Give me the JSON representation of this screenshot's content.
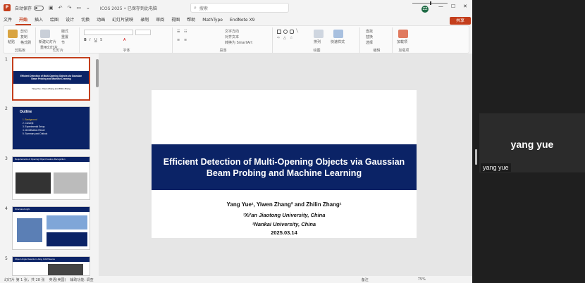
{
  "titlebar": {
    "logo": "P",
    "autosave_label": "自动保存",
    "doc_title": "ICOS 2025 • 已保存到此电脑",
    "search_placeholder": "搜索",
    "user_initials": "ZZ",
    "minimize": "—",
    "maximize": "☐",
    "close": "✕"
  },
  "menu": {
    "tabs": [
      "文件",
      "开始",
      "插入",
      "绘图",
      "设计",
      "切换",
      "动画",
      "幻灯片放映",
      "录制",
      "审阅",
      "视图",
      "帮助",
      "MathType",
      "EndNote X9"
    ],
    "active": "开始",
    "share": "共享"
  },
  "ribbon": {
    "paste": "粘贴",
    "cut": "剪切",
    "copy": "复制",
    "format_painter": "格式刷",
    "clipboard": "剪贴板",
    "new_slide": "新建幻灯片",
    "reuse": "重用幻灯片",
    "layout": "版式",
    "reset": "重置",
    "section": "节",
    "slides": "幻灯片",
    "font": "字体",
    "text_direction": "文字方向",
    "align_text": "对齐文本",
    "smartart": "转换为 SmartArt",
    "paragraph": "段落",
    "arrange": "排列",
    "quick_styles": "快速样式",
    "drawing": "绘图",
    "find": "查找",
    "replace": "替换",
    "select": "选择",
    "editing": "编辑",
    "addin": "加载项",
    "addins": "加载项"
  },
  "thumbnails": [
    {
      "num": "1",
      "title": "Efficient Detection of Multi-Opening Objects via Gaussian Beam Probing and Machine Learning",
      "sub": "Yang Yue, Yiwen Zhang and Zhilin Zhang"
    },
    {
      "num": "2",
      "title": "Outline",
      "items": [
        "1. Background",
        "2. Concept",
        "3. Experimental Setup",
        "4. Identification Result",
        "5. Summary and Outlook"
      ]
    },
    {
      "num": "3",
      "title": "Requirements of Opening Object Feature Recognition"
    },
    {
      "num": "4",
      "title": "Structured Light"
    },
    {
      "num": "5",
      "title": "Object Angle Detection Using OAM Beams"
    }
  ],
  "slide": {
    "title_line1": "Efficient Detection of Multi-Opening Objects via Gaussian",
    "title_line2": "Beam Probing and Machine Learning",
    "authors": "Yang Yue¹, Yiwen Zhang² and Zhilin Zhang¹",
    "aff1": "¹Xi’an Jiaotong University, China",
    "aff2": "²Nankai University, China",
    "date": "2025.03.14"
  },
  "status": {
    "slide_pos": "幻灯片 第 1 张，共 28 张",
    "lang": "英语(美国)",
    "access": "辅助功能: 调查",
    "notes": "备注",
    "zoom": "75%"
  },
  "video": {
    "name_big": "yang yue",
    "name_small": "yang yue"
  }
}
